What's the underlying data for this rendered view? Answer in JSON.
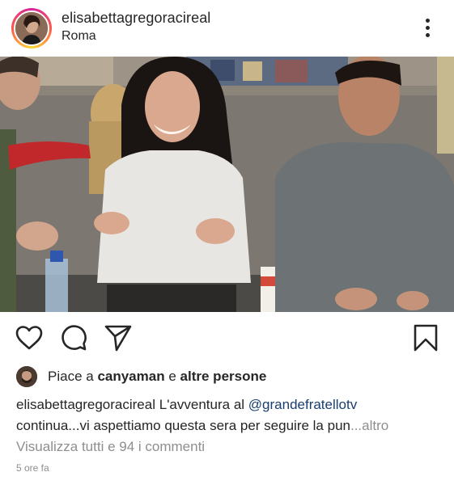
{
  "header": {
    "username": "elisabettagregoracireal",
    "location": "Roma"
  },
  "icons": {
    "avatar": "profile-avatar",
    "more": "more-vertical-icon",
    "like": "heart-icon",
    "comment": "comment-icon",
    "share": "send-icon",
    "save": "bookmark-icon"
  },
  "likes": {
    "prefix": "Piace a",
    "user": "canyaman",
    "conj": "e",
    "others": "altre persone"
  },
  "caption": {
    "user": "elisabettagregoracireal",
    "text_start": "L'avventura al",
    "mention": "@grandefratellotv",
    "text_line2": "continua...vi aspettiamo questa sera per seguire la pun",
    "more": "...altro"
  },
  "comments": {
    "view_all": "Visualizza tutti e 94 i commenti"
  },
  "timestamp": "5 ore fa",
  "colors": {
    "text": "#262626",
    "muted": "#8e8e8e",
    "mention": "#1a3f6e"
  }
}
